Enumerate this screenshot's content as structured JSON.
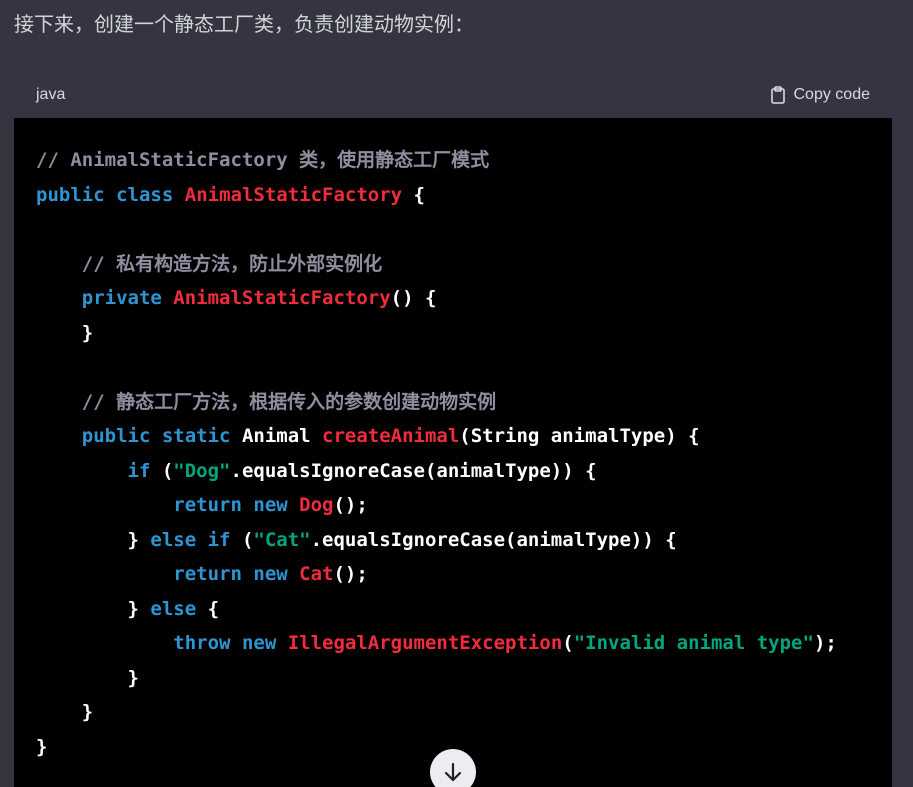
{
  "intro": {
    "text": "接下来，创建一个静态工厂类，负责创建动物实例："
  },
  "code_block": {
    "language": "java",
    "copy_label": "Copy code",
    "copy_icon": "clipboard-icon",
    "lines": [
      {
        "tokens": [
          {
            "text": "// AnimalStaticFactory 类，使用静态工厂模式",
            "type": "comment"
          }
        ]
      },
      {
        "tokens": [
          {
            "text": "public",
            "type": "keyword"
          },
          {
            "text": " ",
            "type": "plain"
          },
          {
            "text": "class",
            "type": "keyword"
          },
          {
            "text": " ",
            "type": "plain"
          },
          {
            "text": "AnimalStaticFactory",
            "type": "title"
          },
          {
            "text": " {",
            "type": "plain"
          }
        ]
      },
      {
        "tokens": []
      },
      {
        "tokens": [
          {
            "text": "    ",
            "type": "plain"
          },
          {
            "text": "// 私有构造方法，防止外部实例化",
            "type": "comment"
          }
        ]
      },
      {
        "tokens": [
          {
            "text": "    ",
            "type": "plain"
          },
          {
            "text": "private",
            "type": "keyword"
          },
          {
            "text": " ",
            "type": "plain"
          },
          {
            "text": "AnimalStaticFactory",
            "type": "title"
          },
          {
            "text": "() {",
            "type": "plain"
          }
        ]
      },
      {
        "tokens": [
          {
            "text": "    }",
            "type": "plain"
          }
        ]
      },
      {
        "tokens": []
      },
      {
        "tokens": [
          {
            "text": "    ",
            "type": "plain"
          },
          {
            "text": "// 静态工厂方法，根据传入的参数创建动物实例",
            "type": "comment"
          }
        ]
      },
      {
        "tokens": [
          {
            "text": "    ",
            "type": "plain"
          },
          {
            "text": "public",
            "type": "keyword"
          },
          {
            "text": " ",
            "type": "plain"
          },
          {
            "text": "static",
            "type": "keyword"
          },
          {
            "text": " Animal ",
            "type": "plain"
          },
          {
            "text": "createAnimal",
            "type": "title"
          },
          {
            "text": "(String animalType) {",
            "type": "plain"
          }
        ]
      },
      {
        "tokens": [
          {
            "text": "        ",
            "type": "plain"
          },
          {
            "text": "if",
            "type": "keyword"
          },
          {
            "text": " (",
            "type": "plain"
          },
          {
            "text": "\"Dog\"",
            "type": "string"
          },
          {
            "text": ".equalsIgnoreCase(animalType)) {",
            "type": "plain"
          }
        ]
      },
      {
        "tokens": [
          {
            "text": "            ",
            "type": "plain"
          },
          {
            "text": "return",
            "type": "keyword"
          },
          {
            "text": " ",
            "type": "plain"
          },
          {
            "text": "new",
            "type": "keyword"
          },
          {
            "text": " ",
            "type": "plain"
          },
          {
            "text": "Dog",
            "type": "title"
          },
          {
            "text": "();",
            "type": "plain"
          }
        ]
      },
      {
        "tokens": [
          {
            "text": "        } ",
            "type": "plain"
          },
          {
            "text": "else",
            "type": "keyword"
          },
          {
            "text": " ",
            "type": "plain"
          },
          {
            "text": "if",
            "type": "keyword"
          },
          {
            "text": " (",
            "type": "plain"
          },
          {
            "text": "\"Cat\"",
            "type": "string"
          },
          {
            "text": ".equalsIgnoreCase(animalType)) {",
            "type": "plain"
          }
        ]
      },
      {
        "tokens": [
          {
            "text": "            ",
            "type": "plain"
          },
          {
            "text": "return",
            "type": "keyword"
          },
          {
            "text": " ",
            "type": "plain"
          },
          {
            "text": "new",
            "type": "keyword"
          },
          {
            "text": " ",
            "type": "plain"
          },
          {
            "text": "Cat",
            "type": "title"
          },
          {
            "text": "();",
            "type": "plain"
          }
        ]
      },
      {
        "tokens": [
          {
            "text": "        } ",
            "type": "plain"
          },
          {
            "text": "else",
            "type": "keyword"
          },
          {
            "text": " {",
            "type": "plain"
          }
        ]
      },
      {
        "tokens": [
          {
            "text": "            ",
            "type": "plain"
          },
          {
            "text": "throw",
            "type": "keyword"
          },
          {
            "text": " ",
            "type": "plain"
          },
          {
            "text": "new",
            "type": "keyword"
          },
          {
            "text": " ",
            "type": "plain"
          },
          {
            "text": "IllegalArgumentException",
            "type": "title"
          },
          {
            "text": "(",
            "type": "plain"
          },
          {
            "text": "\"Invalid animal type\"",
            "type": "string"
          },
          {
            "text": ");",
            "type": "plain"
          }
        ]
      },
      {
        "tokens": [
          {
            "text": "        }",
            "type": "plain"
          }
        ]
      },
      {
        "tokens": [
          {
            "text": "    }",
            "type": "plain"
          }
        ]
      },
      {
        "tokens": [
          {
            "text": "}",
            "type": "plain"
          }
        ]
      }
    ]
  },
  "scroll_button": {
    "icon": "arrow-down-icon"
  },
  "colors": {
    "page_background": "#343541",
    "code_background": "#000000",
    "comment": "#8e8ea0",
    "keyword": "#2e95d3",
    "title": "#f22c3d",
    "string": "#00a67d",
    "plain": "#ffffff"
  }
}
